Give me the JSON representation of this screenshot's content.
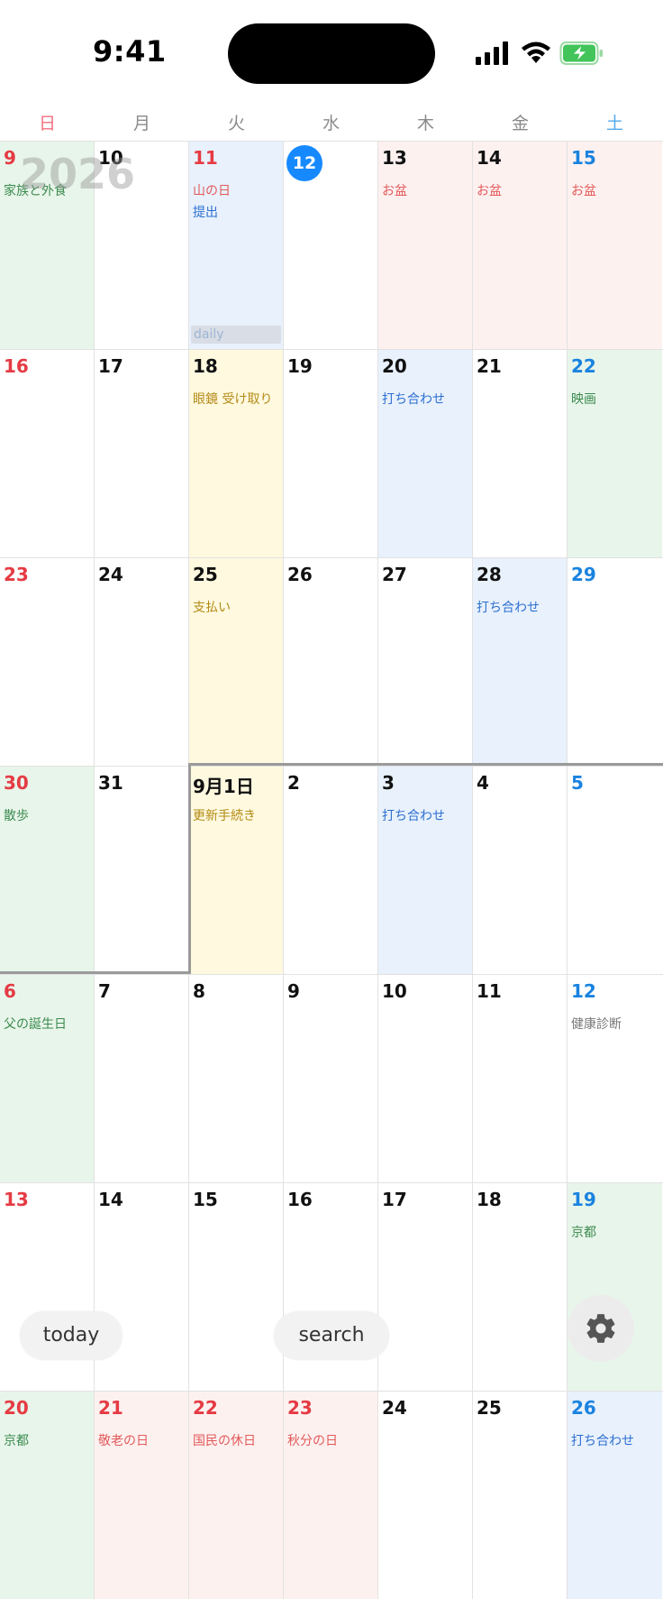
{
  "status": {
    "time": "9:41"
  },
  "year_label": "2026",
  "weekdays": [
    "日",
    "月",
    "火",
    "水",
    "木",
    "金",
    "土"
  ],
  "weeks": [
    [
      {
        "day": "9",
        "color": "red",
        "bg": "green",
        "events": [
          {
            "text": "家族と外食",
            "color": "green"
          }
        ]
      },
      {
        "day": "10",
        "color": "",
        "bg": "",
        "events": []
      },
      {
        "day": "11",
        "color": "red",
        "bg": "blue",
        "events": [
          {
            "text": "山の日",
            "color": "red"
          },
          {
            "text": "提出",
            "color": "blue"
          }
        ],
        "bar": "daily"
      },
      {
        "day": "12",
        "color": "today",
        "bg": "",
        "events": []
      },
      {
        "day": "13",
        "color": "",
        "bg": "pink",
        "events": [
          {
            "text": "お盆",
            "color": "red"
          }
        ]
      },
      {
        "day": "14",
        "color": "",
        "bg": "pink",
        "events": [
          {
            "text": "お盆",
            "color": "red"
          }
        ]
      },
      {
        "day": "15",
        "color": "blue",
        "bg": "pink",
        "events": [
          {
            "text": "お盆",
            "color": "red"
          }
        ]
      }
    ],
    [
      {
        "day": "16",
        "color": "red",
        "bg": "",
        "events": []
      },
      {
        "day": "17",
        "color": "",
        "bg": "",
        "events": []
      },
      {
        "day": "18",
        "color": "",
        "bg": "yellow",
        "events": [
          {
            "text": "眼鏡 受け取り",
            "color": "gold"
          }
        ]
      },
      {
        "day": "19",
        "color": "",
        "bg": "",
        "events": []
      },
      {
        "day": "20",
        "color": "",
        "bg": "blue",
        "events": [
          {
            "text": "打ち合わせ",
            "color": "blue"
          }
        ]
      },
      {
        "day": "21",
        "color": "",
        "bg": "",
        "events": []
      },
      {
        "day": "22",
        "color": "blue",
        "bg": "green",
        "events": [
          {
            "text": "映画",
            "color": "green"
          }
        ]
      }
    ],
    [
      {
        "day": "23",
        "color": "red",
        "bg": "",
        "events": []
      },
      {
        "day": "24",
        "color": "",
        "bg": "",
        "events": []
      },
      {
        "day": "25",
        "color": "",
        "bg": "yellow",
        "events": [
          {
            "text": "支払い",
            "color": "gold"
          }
        ]
      },
      {
        "day": "26",
        "color": "",
        "bg": "",
        "events": []
      },
      {
        "day": "27",
        "color": "",
        "bg": "",
        "events": []
      },
      {
        "day": "28",
        "color": "",
        "bg": "blue",
        "events": [
          {
            "text": "打ち合わせ",
            "color": "blue"
          }
        ]
      },
      {
        "day": "29",
        "color": "blue",
        "bg": "",
        "events": []
      }
    ],
    [
      {
        "day": "30",
        "color": "red",
        "bg": "green",
        "events": [
          {
            "text": "散歩",
            "color": "green"
          }
        ]
      },
      {
        "day": "31",
        "color": "",
        "bg": "",
        "events": []
      },
      {
        "day": "9月1日",
        "color": "",
        "bg": "yellow",
        "events": [
          {
            "text": "更新手続き",
            "color": "gold"
          }
        ]
      },
      {
        "day": "2",
        "color": "",
        "bg": "",
        "events": []
      },
      {
        "day": "3",
        "color": "",
        "bg": "blue",
        "events": [
          {
            "text": "打ち合わせ",
            "color": "blue"
          }
        ]
      },
      {
        "day": "4",
        "color": "",
        "bg": "",
        "events": []
      },
      {
        "day": "5",
        "color": "blue",
        "bg": "",
        "events": []
      }
    ],
    [
      {
        "day": "6",
        "color": "red",
        "bg": "green",
        "events": [
          {
            "text": "父の誕生日",
            "color": "green"
          }
        ]
      },
      {
        "day": "7",
        "color": "",
        "bg": "",
        "events": []
      },
      {
        "day": "8",
        "color": "",
        "bg": "",
        "events": []
      },
      {
        "day": "9",
        "color": "",
        "bg": "",
        "events": []
      },
      {
        "day": "10",
        "color": "",
        "bg": "",
        "events": []
      },
      {
        "day": "11",
        "color": "",
        "bg": "",
        "events": []
      },
      {
        "day": "12",
        "color": "blue",
        "bg": "",
        "events": [
          {
            "text": "健康診断",
            "color": "gray"
          }
        ]
      }
    ],
    [
      {
        "day": "13",
        "color": "red",
        "bg": "",
        "events": []
      },
      {
        "day": "14",
        "color": "",
        "bg": "",
        "events": []
      },
      {
        "day": "15",
        "color": "",
        "bg": "",
        "events": []
      },
      {
        "day": "16",
        "color": "",
        "bg": "",
        "events": []
      },
      {
        "day": "17",
        "color": "",
        "bg": "",
        "events": []
      },
      {
        "day": "18",
        "color": "",
        "bg": "",
        "events": []
      },
      {
        "day": "19",
        "color": "blue",
        "bg": "green",
        "events": [
          {
            "text": "京都",
            "color": "green"
          }
        ]
      }
    ],
    [
      {
        "day": "20",
        "color": "red",
        "bg": "green",
        "events": [
          {
            "text": "京都",
            "color": "green"
          }
        ]
      },
      {
        "day": "21",
        "color": "red",
        "bg": "pink",
        "events": [
          {
            "text": "敬老の日",
            "color": "red"
          }
        ]
      },
      {
        "day": "22",
        "color": "red",
        "bg": "pink",
        "events": [
          {
            "text": "国民の休日",
            "color": "red"
          }
        ]
      },
      {
        "day": "23",
        "color": "red",
        "bg": "pink",
        "events": [
          {
            "text": "秋分の日",
            "color": "red"
          }
        ]
      },
      {
        "day": "24",
        "color": "",
        "bg": "",
        "events": []
      },
      {
        "day": "25",
        "color": "",
        "bg": "",
        "events": []
      },
      {
        "day": "26",
        "color": "blue",
        "bg": "blue",
        "events": [
          {
            "text": "打ち合わせ",
            "color": "blue"
          }
        ]
      }
    ]
  ],
  "buttons": {
    "today": "today",
    "search": "search"
  },
  "icons": {
    "settings": "gear-icon"
  },
  "colors": {
    "accent": "#1689ff",
    "sunday": "#e53b44",
    "saturday": "#1a83e0"
  }
}
